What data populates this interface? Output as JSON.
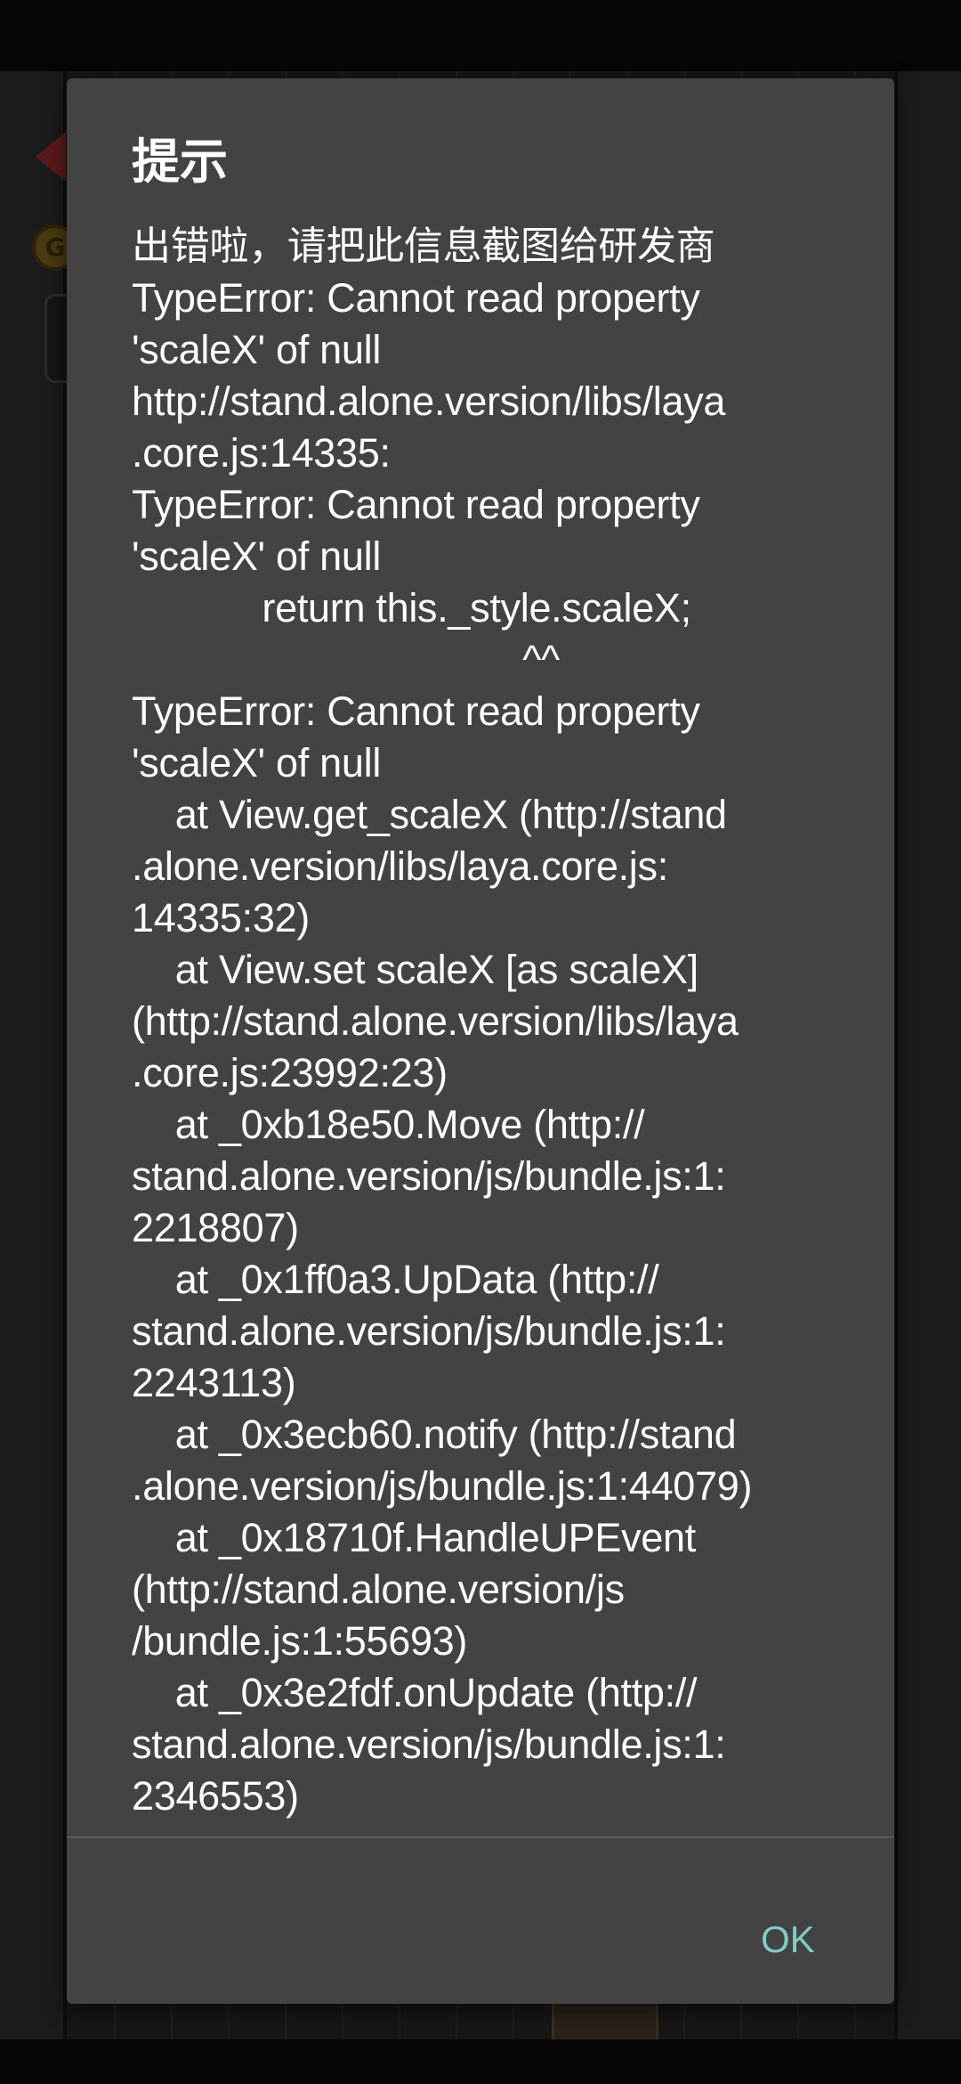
{
  "dialog": {
    "title": "提示",
    "lines": [
      "出错啦，请把此信息截图给研发商",
      "TypeError: Cannot read property",
      "'scaleX' of null",
      "http://stand.alone.version/libs/laya",
      ".core.js:14335:",
      "TypeError: Cannot read property",
      "'scaleX' of null",
      "            return this._style.scaleX;",
      "                                    ^^",
      "TypeError: Cannot read property",
      "'scaleX' of null",
      "    at View.get_scaleX (http://stand",
      ".alone.version/libs/laya.core.js:",
      "14335:32)",
      "    at View.set scaleX [as scaleX]",
      "(http://stand.alone.version/libs/laya",
      ".core.js:23992:23)",
      "    at _0xb18e50.Move (http://",
      "stand.alone.version/js/bundle.js:1:",
      "2218807)",
      "    at _0x1ff0a3.UpData (http://",
      "stand.alone.version/js/bundle.js:1:",
      "2243113)",
      "    at _0x3ecb60.notify (http://stand",
      ".alone.version/js/bundle.js:1:44079)",
      "    at _0x18710f.HandleUPEvent",
      "(http://stand.alone.version/js",
      "/bundle.js:1:55693)",
      "    at _0x3e2fdf.onUpdate (http://",
      "stand.alone.version/js/bundle.js:1:",
      "2346553)"
    ],
    "ok_label": "OK"
  },
  "background": {
    "coin_icon_letter": "G"
  },
  "colors": {
    "dialog_bg": "#434343",
    "accent": "#80cbc4",
    "text": "#ffffff"
  }
}
